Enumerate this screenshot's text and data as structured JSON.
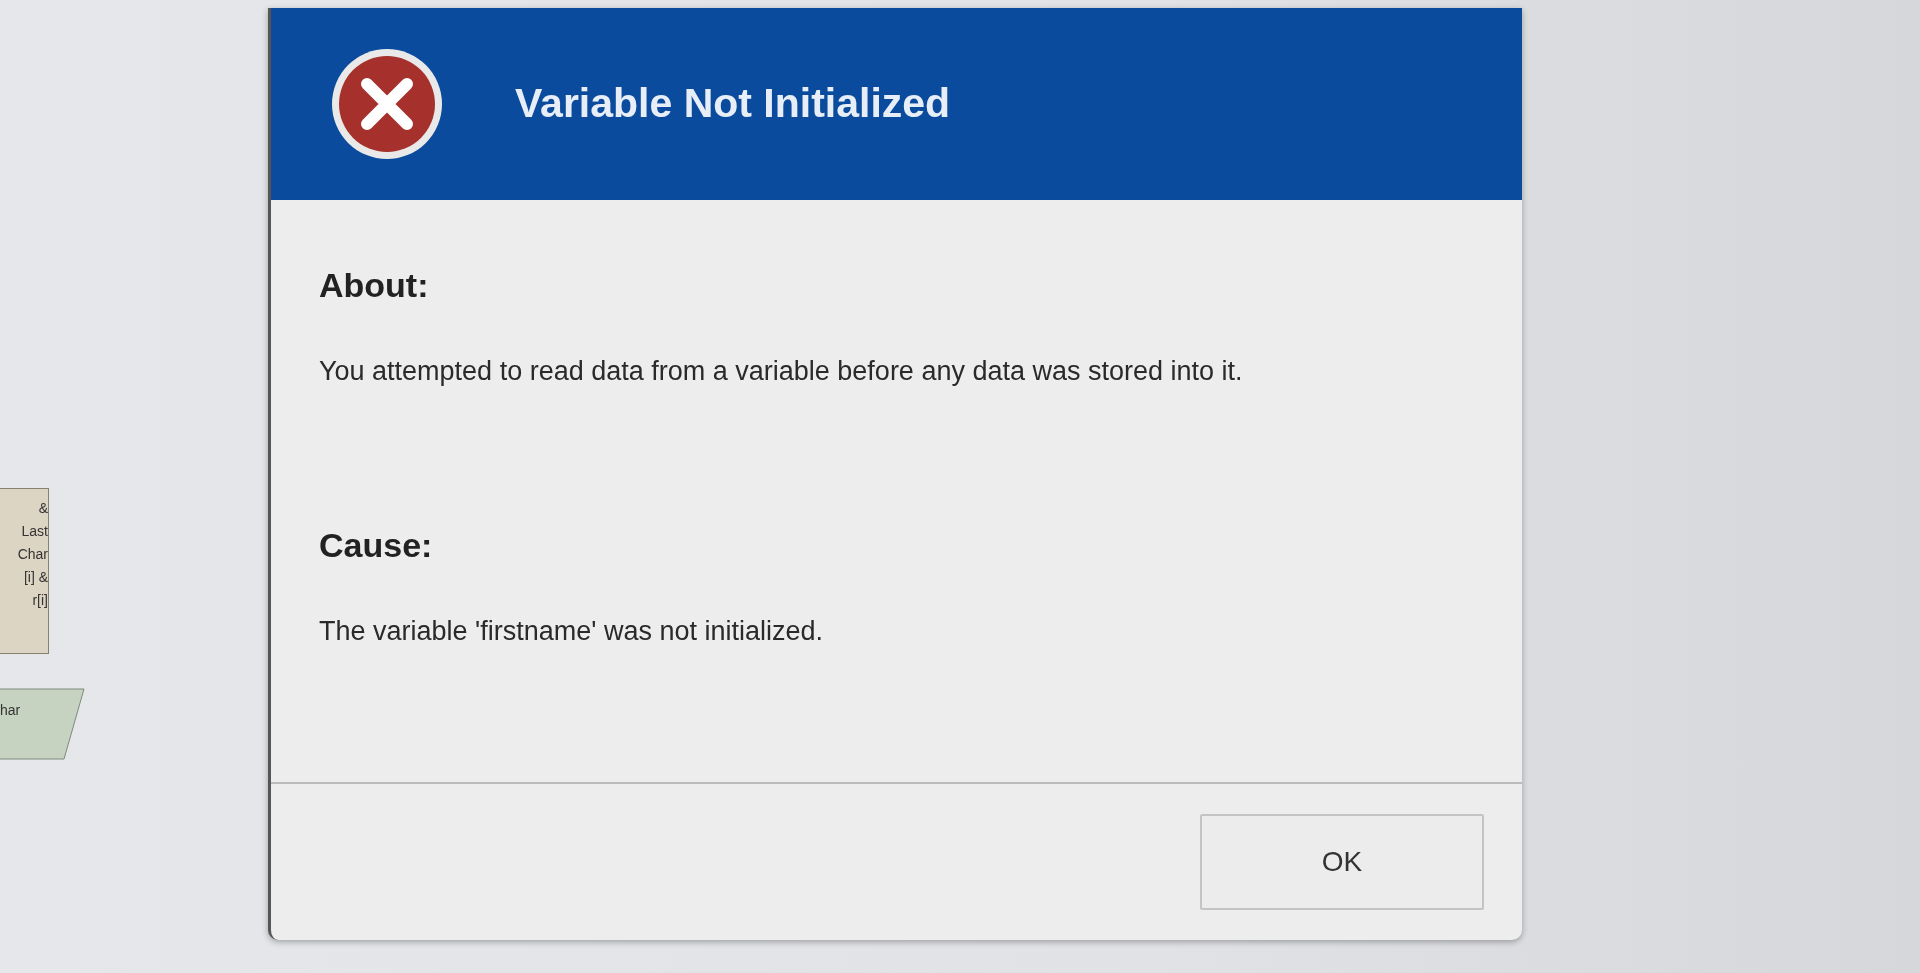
{
  "background_flowchart": {
    "process_box": {
      "lines": [
        "&",
        "Last",
        "Char",
        "[i] &",
        "r[i]"
      ]
    },
    "io_shape": {
      "label": "har"
    }
  },
  "dialog": {
    "title": "Variable Not Initialized",
    "sections": [
      {
        "heading": "About:",
        "text": "You attempted to read data from a variable before any data was stored into it."
      },
      {
        "heading": "Cause:",
        "text": "The variable 'firstname' was not initialized."
      }
    ],
    "buttons": [
      "OK"
    ]
  }
}
